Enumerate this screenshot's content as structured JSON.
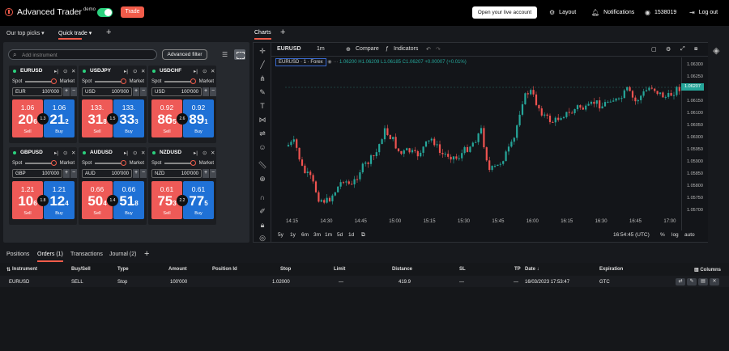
{
  "header": {
    "app_name": "Advanced Trader",
    "app_sup": "demo",
    "trade_label": "Trade",
    "live_account_label": "Open your live account",
    "layout_label": "Layout",
    "notifications_label": "Notifications",
    "account_id": "1538019",
    "logout_label": "Log out"
  },
  "left_tabs": {
    "top_picks": "Our top picks ▾",
    "quick_trade": "Quick trade ▾"
  },
  "search": {
    "placeholder": "Add instrument"
  },
  "advanced_filter_label": "Advanced filter",
  "tiles": [
    {
      "symbol": "EURUSD",
      "currency": "EUR",
      "qty": "100'000",
      "spread": "1.3",
      "sell_small": "1.06",
      "sell_big": "20",
      "sell_sub": "6",
      "buy_small": "1.06",
      "buy_big": "21",
      "buy_sub": "2"
    },
    {
      "symbol": "USDJPY",
      "currency": "USD",
      "qty": "100'000",
      "spread": "1.5",
      "sell_small": "133.",
      "sell_big": "31",
      "sell_sub": "8",
      "buy_small": "133.",
      "buy_big": "33",
      "buy_sub": "3"
    },
    {
      "symbol": "USDCHF",
      "currency": "USD",
      "qty": "100'000",
      "spread": "2.6",
      "sell_small": "0.92",
      "sell_big": "86",
      "sell_sub": "5",
      "buy_small": "0.92",
      "buy_big": "89",
      "buy_sub": "1"
    },
    {
      "symbol": "GBPUSD",
      "currency": "GBP",
      "qty": "100'000",
      "spread": "1.8",
      "sell_small": "1.21",
      "sell_big": "10",
      "sell_sub": "6",
      "buy_small": "1.21",
      "buy_big": "12",
      "buy_sub": "4"
    },
    {
      "symbol": "AUDUSD",
      "currency": "AUD",
      "qty": "100'000",
      "spread": "1.4",
      "sell_small": "0.66",
      "sell_big": "50",
      "sell_sub": "4",
      "buy_small": "0.66",
      "buy_big": "51",
      "buy_sub": "8"
    },
    {
      "symbol": "NZDUSD",
      "currency": "NZD",
      "qty": "100'000",
      "spread": "2.2",
      "sell_small": "0.61",
      "sell_big": "75",
      "sell_sub": "3",
      "buy_small": "0.61",
      "buy_big": "77",
      "buy_sub": "5"
    }
  ],
  "tile_labels": {
    "spot": "Spot",
    "market": "Market",
    "sell": "Sell",
    "buy": "Buy"
  },
  "charts": {
    "tab_label": "Charts",
    "symbol": "EURUSD",
    "interval": "1m",
    "compare_label": "Compare",
    "indicators_label": "Indicators",
    "legend_name": "EURUSD · 1 · Forex",
    "legend_ohlc": "1.06200 H1.06209 L1.06185 C1.06207 +0.00007 (+0.01%)",
    "last_price": "1.06207",
    "price_labels": [
      "1.06300",
      "1.06250",
      "1.06200",
      "1.06150",
      "1.06100",
      "1.06050",
      "1.06000",
      "1.05950",
      "1.05900",
      "1.05850",
      "1.05800",
      "1.05750",
      "1.05700"
    ],
    "time_labels": [
      "14:15",
      "14:30",
      "14:45",
      "15:00",
      "15:15",
      "15:30",
      "15:45",
      "16:00",
      "16:15",
      "16:30",
      "16:45",
      "17:00"
    ],
    "ranges": [
      "5y",
      "1y",
      "6m",
      "3m",
      "1m",
      "5d",
      "1d"
    ],
    "clock": "16:54:45 (UTC)",
    "pct": "%",
    "log": "log",
    "auto": "auto"
  },
  "bottom_tabs": {
    "positions": "Positions",
    "orders": "Orders (1)",
    "transactions": "Transactions",
    "journal": "Journal (2)"
  },
  "orders": {
    "headers": {
      "instrument": "Instrument",
      "side": "Buy/Sell",
      "type": "Type",
      "amount": "Amount",
      "position_id": "Position Id",
      "stop": "Stop",
      "limit": "Limit",
      "distance": "Distance",
      "sl": "SL",
      "tp": "TP",
      "date": "Date ↓",
      "expiration": "Expiration",
      "columns": "Columns"
    },
    "row": {
      "instrument": "EURUSD",
      "side": "SELL",
      "type": "Stop",
      "amount": "100'000",
      "stop": "1.02000",
      "limit": "—",
      "distance": "419.9",
      "sl": "—",
      "tp": "—",
      "date": "16/03/2023 17:53:47",
      "expiration": "GTC"
    }
  },
  "colors": {
    "accent": "#f25c4a",
    "sell": "#ee5a57",
    "buy": "#1f71d6",
    "up": "#26a69a",
    "down": "#ef5350",
    "toggle": "#2bd17e"
  }
}
